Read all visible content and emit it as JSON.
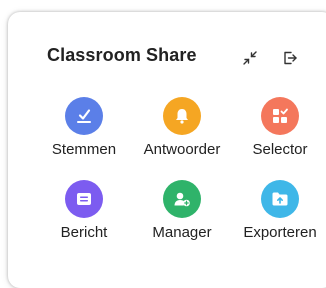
{
  "panel": {
    "title": "Classroom Share",
    "actions": [
      {
        "name": "minimize",
        "icon": "minimize-arrows-icon"
      },
      {
        "name": "exit",
        "icon": "exit-icon"
      }
    ]
  },
  "tools": [
    {
      "label": "Stemmen",
      "icon": "vote-icon",
      "color": "#5B7FE8"
    },
    {
      "label": "Antwoorder",
      "icon": "bell-icon",
      "color": "#F5A623"
    },
    {
      "label": "Selector",
      "icon": "selector-grid-icon",
      "color": "#F4775C"
    },
    {
      "label": "Bericht",
      "icon": "message-icon",
      "color": "#7C5CF0"
    },
    {
      "label": "Manager",
      "icon": "add-user-icon",
      "color": "#2FB36A"
    },
    {
      "label": "Exporteren",
      "icon": "export-folder-icon",
      "color": "#3FB7E8"
    }
  ]
}
